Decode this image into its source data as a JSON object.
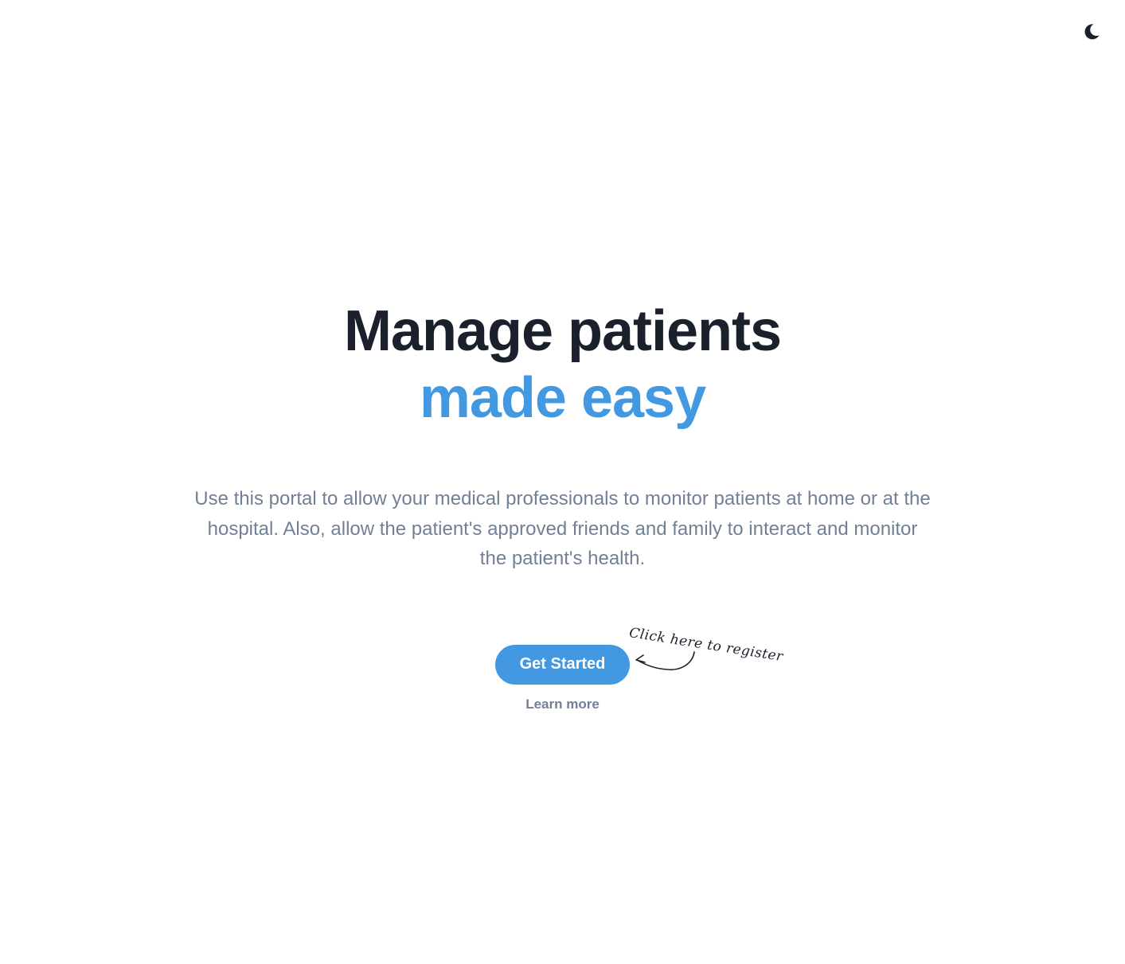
{
  "header": {
    "theme_toggle_icon": "moon-icon"
  },
  "hero": {
    "headline_line1": "Manage patients",
    "headline_line2": "made easy",
    "description": "Use this portal to allow your medical professionals to monitor patients at home or at the hospital. Also, allow the patient's approved friends and family to interact and monitor the patient's health.",
    "primary_button_label": "Get Started",
    "secondary_link_label": "Learn more",
    "annotation_text": "Click here to register",
    "arrow_icon": "curved-arrow-icon"
  },
  "colors": {
    "accent": "#4299e1",
    "heading": "#1a202c",
    "muted": "#718096",
    "background": "#ffffff"
  }
}
